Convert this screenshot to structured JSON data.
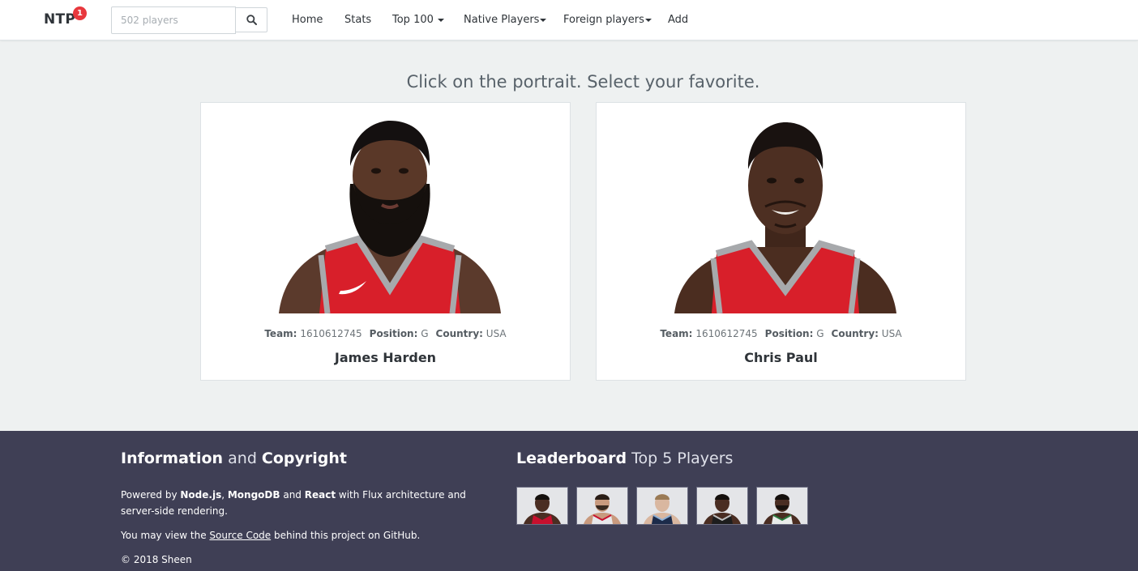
{
  "navbar": {
    "brand": "NTP",
    "badge_count": "1",
    "search": {
      "placeholder": "502 players",
      "value": ""
    },
    "items": [
      {
        "label": "Home",
        "dropdown": false
      },
      {
        "label": "Stats",
        "dropdown": false
      },
      {
        "label": "Top 100",
        "dropdown": true
      },
      {
        "label": "Native Players",
        "dropdown": true
      },
      {
        "label": "Foreign players",
        "dropdown": true
      },
      {
        "label": "Add",
        "dropdown": false
      }
    ]
  },
  "main": {
    "headline": "Click on the portrait. Select your favorite.",
    "cards": [
      {
        "team_label": "Team:",
        "team": "1610612745",
        "position_label": "Position:",
        "position": "G",
        "country_label": "Country:",
        "country": "USA",
        "name": "James Harden",
        "jersey_color": "#d81f2a",
        "trim_color": "#a7a9ac"
      },
      {
        "team_label": "Team:",
        "team": "1610612745",
        "position_label": "Position:",
        "position": "G",
        "country_label": "Country:",
        "country": "USA",
        "name": "Chris Paul",
        "jersey_color": "#d81f2a",
        "trim_color": "#a7a9ac"
      }
    ]
  },
  "footer": {
    "info": {
      "title_bold_1": "Information",
      "title_mid": " and ",
      "title_bold_2": "Copyright",
      "line1": {
        "pre": "Powered by ",
        "node": "Node.js",
        "comma": ", ",
        "mongo": "MongoDB",
        "and": " and ",
        "react": "React",
        "post": " with Flux architecture and server-side rendering."
      },
      "line2": {
        "pre": "You may view the ",
        "link": "Source Code",
        "post": " behind this project on GitHub."
      },
      "copyright": "© 2018 Sheen"
    },
    "leaderboard": {
      "title_bold": "Leaderboard",
      "title_rest": " Top 5 Players",
      "thumbs": [
        {
          "jersey": "#c8102e"
        },
        {
          "jersey": "#e8e8ea"
        },
        {
          "jersey": "#1c2b4a"
        },
        {
          "jersey": "#1d1d1d"
        },
        {
          "jersey": "#e9ecea"
        }
      ]
    }
  },
  "colors": {
    "navbar_bg": "#ffffff",
    "page_bg": "#eef1f1",
    "footer_bg": "#3f3f55",
    "badge": "#e8383d"
  }
}
